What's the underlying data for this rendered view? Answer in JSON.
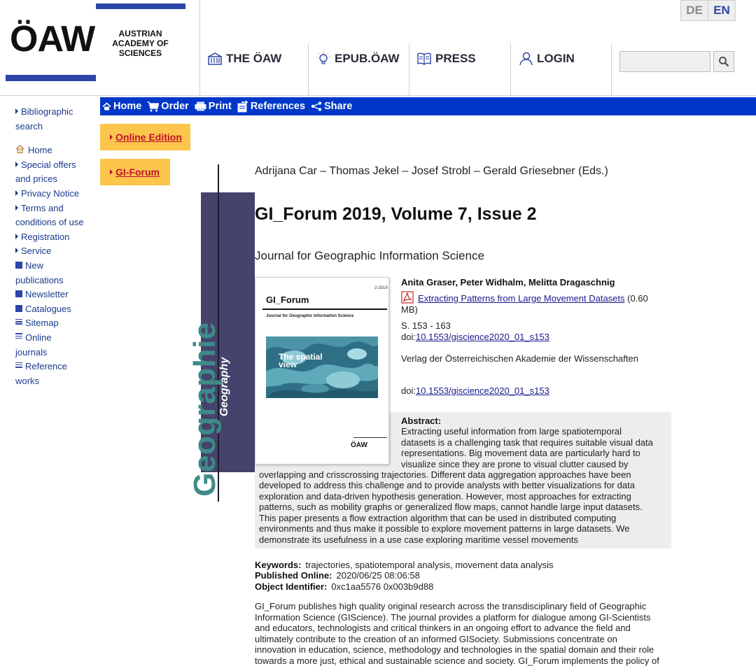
{
  "header": {
    "logo_abbr": "ÖAW",
    "logo_lines": [
      "AUSTRIAN",
      "ACADEMY OF",
      "SCIENCES"
    ],
    "nav": [
      {
        "label": "THE ÖAW",
        "icon": "building-icon"
      },
      {
        "label": "EPUB.ÖAW",
        "icon": "lightbulb-icon"
      },
      {
        "label": "PRESS",
        "icon": "book-icon"
      },
      {
        "label": "LOGIN",
        "icon": "user-icon"
      }
    ],
    "languages": [
      "DE",
      "EN"
    ],
    "active_language": "EN",
    "search": {
      "value": "",
      "icon": "search-icon"
    }
  },
  "sidebar": {
    "items": [
      {
        "label": "Bibliographic search",
        "icon": "triangle"
      },
      {
        "label": "Home",
        "icon": "home-icon"
      },
      {
        "label": "Special offers and prices",
        "icon": "triangle"
      },
      {
        "label": "Privacy Notice",
        "icon": "triangle"
      },
      {
        "label": "Terms and conditions of use",
        "icon": "triangle"
      },
      {
        "label": "Registration",
        "icon": "triangle"
      },
      {
        "label": "Service",
        "icon": "triangle"
      },
      {
        "label": "New publications",
        "icon": "square"
      },
      {
        "label": "Newsletter",
        "icon": "square"
      },
      {
        "label": "Catalogues",
        "icon": "square"
      },
      {
        "label": "Sitemap",
        "icon": "lines"
      },
      {
        "label": "Online journals",
        "icon": "lines"
      },
      {
        "label": "Reference works",
        "icon": "lines"
      }
    ]
  },
  "toolbar": {
    "items": [
      {
        "label": "Home",
        "icon": "home-icon"
      },
      {
        "label": "Order",
        "icon": "cart-icon"
      },
      {
        "label": "Print",
        "icon": "print-icon"
      },
      {
        "label": "References",
        "icon": "references-icon"
      },
      {
        "label": "Share",
        "icon": "share-icon"
      }
    ]
  },
  "buttons": {
    "online_edition": "Online Edition",
    "gi_forum": "GI-Forum"
  },
  "band": {
    "big_text": "Geographie",
    "small_text": "Geography"
  },
  "publication": {
    "editors": "Adrijana Car – Thomas Jekel – Josef Strobl – Gerald Griesebner (Eds.)",
    "title": "GI_Forum 2019, Volume 7, Issue 2",
    "subtitle": "Journal for Geographic Information Science"
  },
  "cover": {
    "issue": "2-2019",
    "title": "GI_Forum",
    "subtitle": "Journal for Geographic Information Science",
    "image_text_1": "The spatial",
    "image_text_2": "view",
    "publisher_mark": "ÖAW"
  },
  "article": {
    "authors": "Anita Graser, Peter Widhalm, Melitta Dragaschnig",
    "pdf_link": "Extracting Patterns from Large Movement Datasets",
    "pdf_size": "(0.60 MB)",
    "pages": "S.  153 - 163",
    "doi_prefix": "doi:",
    "doi": "10.1553/giscience2020_01_s153",
    "publisher": "Verlag der Österreichischen Akademie der Wissenschaften",
    "abstract_label": "Abstract:",
    "abstract_lines_narrow": [
      "Extracting useful information from large spatiotemporal",
      "datasets is a challenging task that requires suitable visual data",
      "representations. Big movement data are particularly hard to",
      "visualize since they are prone to visual clutter caused by"
    ],
    "abstract_lines_wide": [
      "overlapping and crisscrossing trajectories. Different data aggregation approaches have been",
      "developed to address this challenge and to provide analysts with better visualizations for data",
      "exploration and data-driven hypothesis generation. However, most approaches for extracting",
      "patterns, such as mobility graphs or generalized flow maps, cannot handle large input datasets.",
      "This paper presents a flow extraction algorithm that can be used in distributed computing",
      "environments and thus make it possible to explore movement patterns in large datasets. We",
      "demonstrate its usefulness in a use case exploring maritime vessel movements"
    ]
  },
  "meta": {
    "keywords_label": "Keywords:",
    "keywords": "trajectories, spatiotemporal analysis, movement data analysis",
    "published_label": "Published Online:",
    "published": "2020/06/25 08:06:58",
    "object_label": "Object Identifier:",
    "object_id": "0xc1aa5576 0x003b9d88"
  },
  "description_lines": [
    "GI_Forum publishes high quality original research across the transdisciplinary field of Geographic",
    "Information Science (GIScience). The journal provides a platform for dialogue among GI-Scientists",
    "and educators, technologists and critical thinkers in an ongoing effort to advance the field and",
    "ultimately contribute to the creation of an informed GISociety. Submissions concentrate on",
    "innovation in education, science, methodology and technologies in the spatial domain and their role",
    "towards a more just, ethical and sustainable science and society. GI_Forum implements the policy of"
  ],
  "colors": {
    "brand_blue": "#2b46a6",
    "toolbar_blue": "#0037c8",
    "accent_yellow": "#fcc64c",
    "band_purple": "#45436b",
    "geo_teal": "#3e8a87"
  }
}
